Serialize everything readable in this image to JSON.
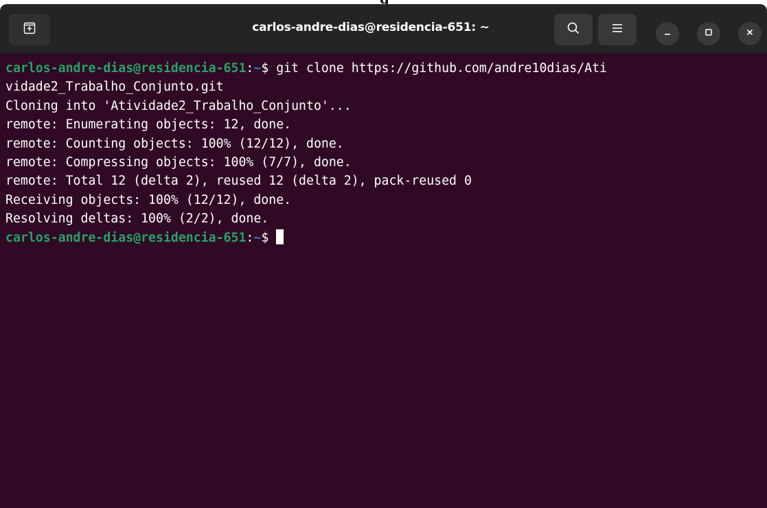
{
  "window": {
    "title": "carlos-andre-dias@residencia-651: ~"
  },
  "icons": {
    "new_tab": "new-tab-icon",
    "search": "search-icon",
    "menu": "hamburger-menu-icon",
    "minimize": "minimize-icon",
    "maximize": "maximize-icon",
    "close": "close-icon"
  },
  "colors": {
    "terminal_bg": "#300a24",
    "titlebar_bg": "#242424",
    "prompt_user": "#26a269",
    "prompt_path": "#2a7bde",
    "text": "#ffffff"
  },
  "terminal": {
    "prompt_user_host": "carlos-andre-dias@residencia-651",
    "prompt_colon": ":",
    "prompt_path": "~",
    "prompt_symbol": "$ ",
    "command": "git clone https://github.com/andre10dias/Ati",
    "command_wrap": "vidade2_Trabalho_Conjunto.git",
    "output": [
      "Cloning into 'Atividade2_Trabalho_Conjunto'...",
      "remote: Enumerating objects: 12, done.",
      "remote: Counting objects: 100% (12/12), done.",
      "remote: Compressing objects: 100% (7/7), done.",
      "remote: Total 12 (delta 2), reused 12 (delta 2), pack-reused 0",
      "Receiving objects: 100% (12/12), done.",
      "Resolving deltas: 100% (2/2), done."
    ]
  }
}
